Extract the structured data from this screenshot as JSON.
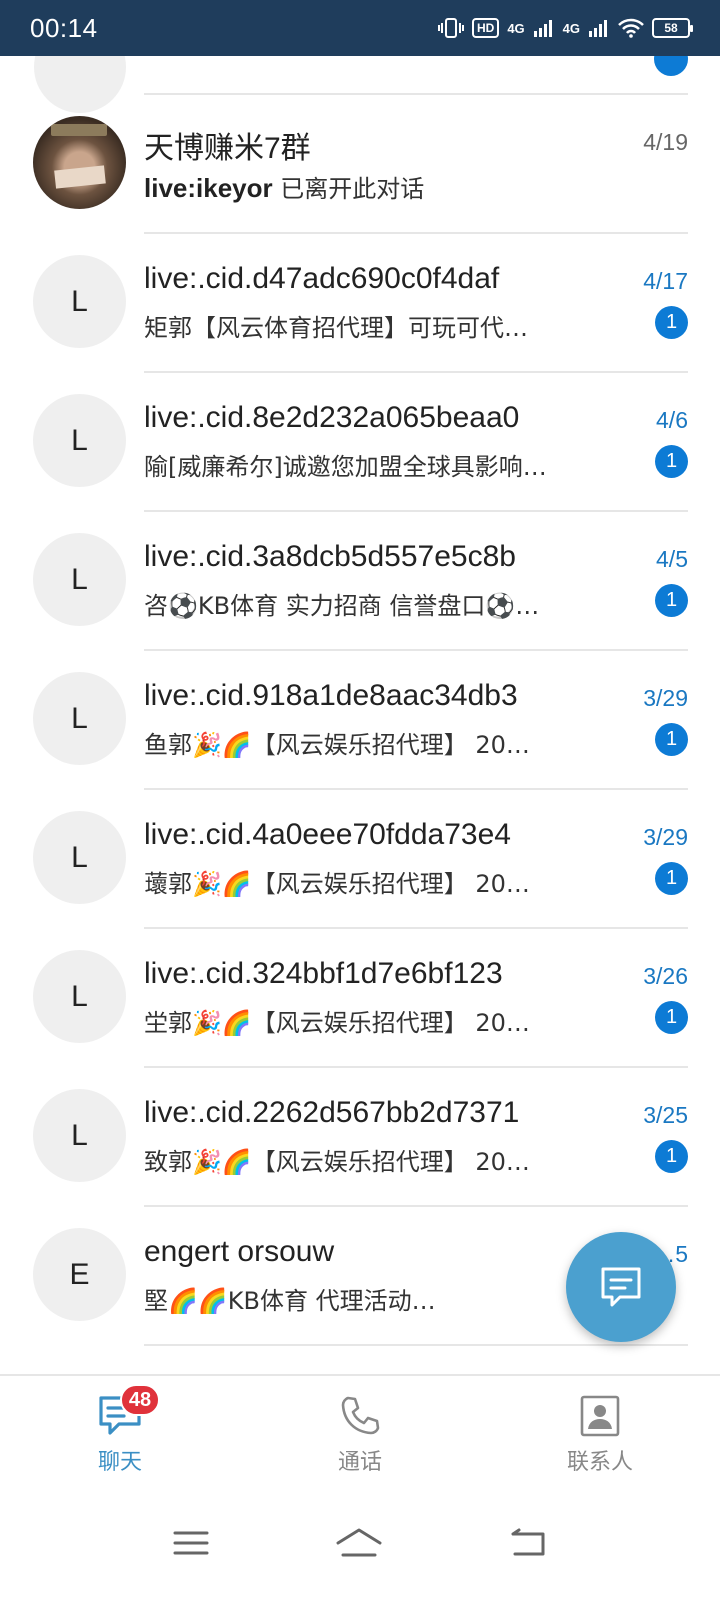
{
  "status_bar": {
    "time": "00:14",
    "hd_label": "HD",
    "sim1_label": "4G",
    "sim2_label": "4G",
    "battery": "58"
  },
  "chats": [
    {
      "avatar_letter": "",
      "avatar_type": "photo",
      "title": "天博赚米7群",
      "preview_bold": "live:ikeyor",
      "preview": " 已离开此对话",
      "date": "4/19",
      "unread": ""
    },
    {
      "avatar_letter": "L",
      "title": "live:.cid.d47adc690c0f4daf",
      "preview_bold": "",
      "preview": "矩郭【风云体育招代理】可玩可代…",
      "date": "4/17",
      "unread": "1"
    },
    {
      "avatar_letter": "L",
      "title": "live:.cid.8e2d232a065beaa0",
      "preview_bold": "",
      "preview": "隃[威廉希尔]诚邀您加盟全球具影响…",
      "date": "4/6",
      "unread": "1"
    },
    {
      "avatar_letter": "L",
      "title": "live:.cid.3a8dcb5d557e5c8b",
      "preview_bold": "",
      "preview": "咨⚽KB体育 实力招商 信誉盘口⚽…",
      "date": "4/5",
      "unread": "1"
    },
    {
      "avatar_letter": "L",
      "title": "live:.cid.918a1de8aac34db3",
      "preview_bold": "",
      "preview": "鱼郭🎉🌈【风云娱乐招代理】 20…",
      "date": "3/29",
      "unread": "1"
    },
    {
      "avatar_letter": "L",
      "title": "live:.cid.4a0eee70fdda73e4",
      "preview_bold": "",
      "preview": "蘾郭🎉🌈【风云娱乐招代理】 20…",
      "date": "3/29",
      "unread": "1"
    },
    {
      "avatar_letter": "L",
      "title": "live:.cid.324bbf1d7e6bf123",
      "preview_bold": "",
      "preview": "坣郭🎉🌈【风云娱乐招代理】 20…",
      "date": "3/26",
      "unread": "1"
    },
    {
      "avatar_letter": "L",
      "title": "live:.cid.2262d567bb2d7371",
      "preview_bold": "",
      "preview": "致郭🎉🌈【风云娱乐招代理】 20…",
      "date": "3/25",
      "unread": "1"
    },
    {
      "avatar_letter": "E",
      "title": "engert orsouw",
      "preview_bold": "",
      "preview": "堅🌈🌈KB体育  代理活动…",
      "date": "…5",
      "unread": ""
    }
  ],
  "tabs": {
    "chat": {
      "label": "聊天",
      "count": "48"
    },
    "calls": {
      "label": "通话"
    },
    "contacts": {
      "label": "联系人"
    }
  },
  "colors": {
    "status_bar": "#1f3d5c",
    "accent": "#3b8fc4",
    "badge": "#0d7bd5",
    "fab": "#4ba0cf",
    "count_badge": "#e0323b"
  }
}
